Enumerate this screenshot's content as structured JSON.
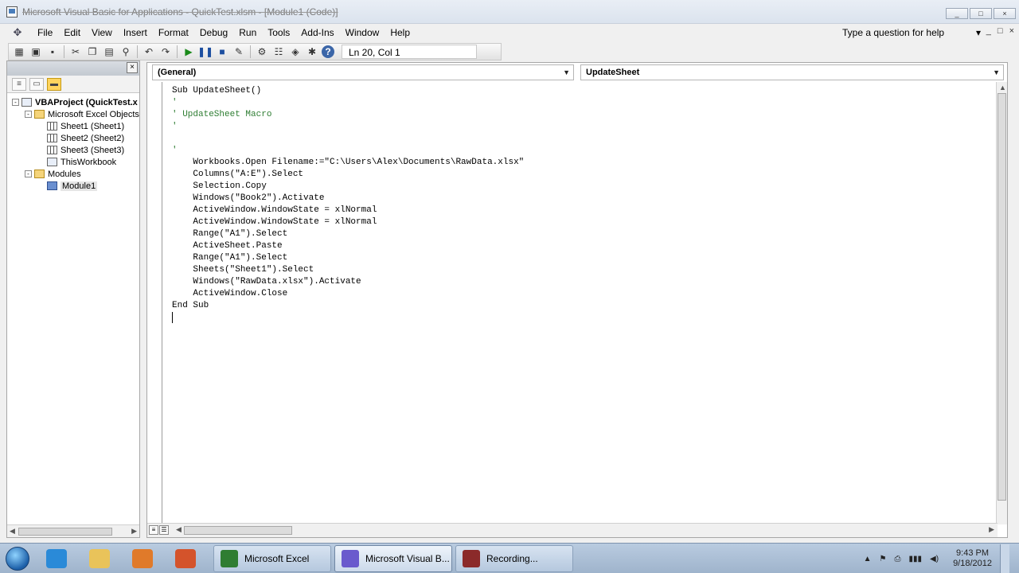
{
  "window": {
    "title": "Microsoft Visual Basic for Applications - QuickTest.xlsm - [Module1 (Code)]",
    "controls": [
      "_",
      "□",
      "×"
    ]
  },
  "menu": {
    "items": [
      "File",
      "Edit",
      "View",
      "Insert",
      "Format",
      "Debug",
      "Run",
      "Tools",
      "Add-Ins",
      "Window",
      "Help"
    ],
    "help_box": "Type a question for help",
    "doc_controls": [
      "_",
      "□",
      "×"
    ]
  },
  "toolbar": {
    "cursor_position": "Ln 20, Col 1",
    "icons": [
      "view-excel-icon",
      "insert-module-icon",
      "save-icon",
      "cut-icon",
      "copy-icon",
      "paste-icon",
      "find-icon",
      "undo-icon",
      "redo-icon",
      "run-icon",
      "break-icon",
      "reset-icon",
      "design-mode-icon",
      "project-explorer-icon",
      "properties-icon",
      "object-browser-icon",
      "toolbox-icon",
      "help-icon"
    ]
  },
  "project_explorer": {
    "tree": [
      {
        "label": "VBAProject (QuickTest.x",
        "level": 0,
        "icon": "vbaproject-icon",
        "expander": "-"
      },
      {
        "label": "Microsoft Excel Objects",
        "level": 1,
        "icon": "folder-icon",
        "expander": "-"
      },
      {
        "label": "Sheet1 (Sheet1)",
        "level": 2,
        "icon": "sheet-icon",
        "expander": ""
      },
      {
        "label": "Sheet2 (Sheet2)",
        "level": 2,
        "icon": "sheet-icon",
        "expander": ""
      },
      {
        "label": "Sheet3 (Sheet3)",
        "level": 2,
        "icon": "sheet-icon",
        "expander": ""
      },
      {
        "label": "ThisWorkbook",
        "level": 2,
        "icon": "workbook-icon",
        "expander": ""
      },
      {
        "label": "Modules",
        "level": 1,
        "icon": "folder-icon",
        "expander": "-"
      },
      {
        "label": "Module1",
        "level": 2,
        "icon": "module-icon",
        "expander": ""
      }
    ]
  },
  "code_window": {
    "object_combo": "(General)",
    "procedure_combo": "UpdateSheet",
    "lines": [
      {
        "text": "Sub UpdateSheet()",
        "comment": false
      },
      {
        "text": "'",
        "comment": true
      },
      {
        "text": "' UpdateSheet Macro",
        "comment": true
      },
      {
        "text": "'",
        "comment": true
      },
      {
        "text": "",
        "comment": false
      },
      {
        "text": "'",
        "comment": true
      },
      {
        "text": "    Workbooks.Open Filename:=\"C:\\Users\\Alex\\Documents\\RawData.xlsx\"",
        "comment": false
      },
      {
        "text": "    Columns(\"A:E\").Select",
        "comment": false
      },
      {
        "text": "    Selection.Copy",
        "comment": false
      },
      {
        "text": "    Windows(\"Book2\").Activate",
        "comment": false
      },
      {
        "text": "    ActiveWindow.WindowState = xlNormal",
        "comment": false
      },
      {
        "text": "    ActiveWindow.WindowState = xlNormal",
        "comment": false
      },
      {
        "text": "    Range(\"A1\").Select",
        "comment": false
      },
      {
        "text": "    ActiveSheet.Paste",
        "comment": false
      },
      {
        "text": "    Range(\"A1\").Select",
        "comment": false
      },
      {
        "text": "    Sheets(\"Sheet1\").Select",
        "comment": false
      },
      {
        "text": "    Windows(\"RawData.xlsx\").Activate",
        "comment": false
      },
      {
        "text": "    ActiveWindow.Close",
        "comment": false
      },
      {
        "text": "End Sub",
        "comment": false
      }
    ]
  },
  "taskbar": {
    "pinned": [
      {
        "icon": "internet-explorer-icon",
        "color": "#2a8ad8"
      },
      {
        "icon": "file-explorer-icon",
        "color": "#e9c35a"
      },
      {
        "icon": "media-player-icon",
        "color": "#e07a2a"
      },
      {
        "icon": "powerpoint-icon",
        "color": "#d4532b"
      }
    ],
    "tasks": [
      {
        "label": "Microsoft Excel",
        "icon": "excel-icon",
        "color": "#2f7d32",
        "active": false
      },
      {
        "label": "Microsoft Visual B...",
        "icon": "vba-icon",
        "color": "#6a5acd",
        "active": true
      },
      {
        "label": "Recording...",
        "icon": "recorder-icon",
        "color": "#8b2a2a",
        "active": false
      }
    ],
    "clock_time": "9:43 PM",
    "clock_date": "9/18/2012"
  }
}
